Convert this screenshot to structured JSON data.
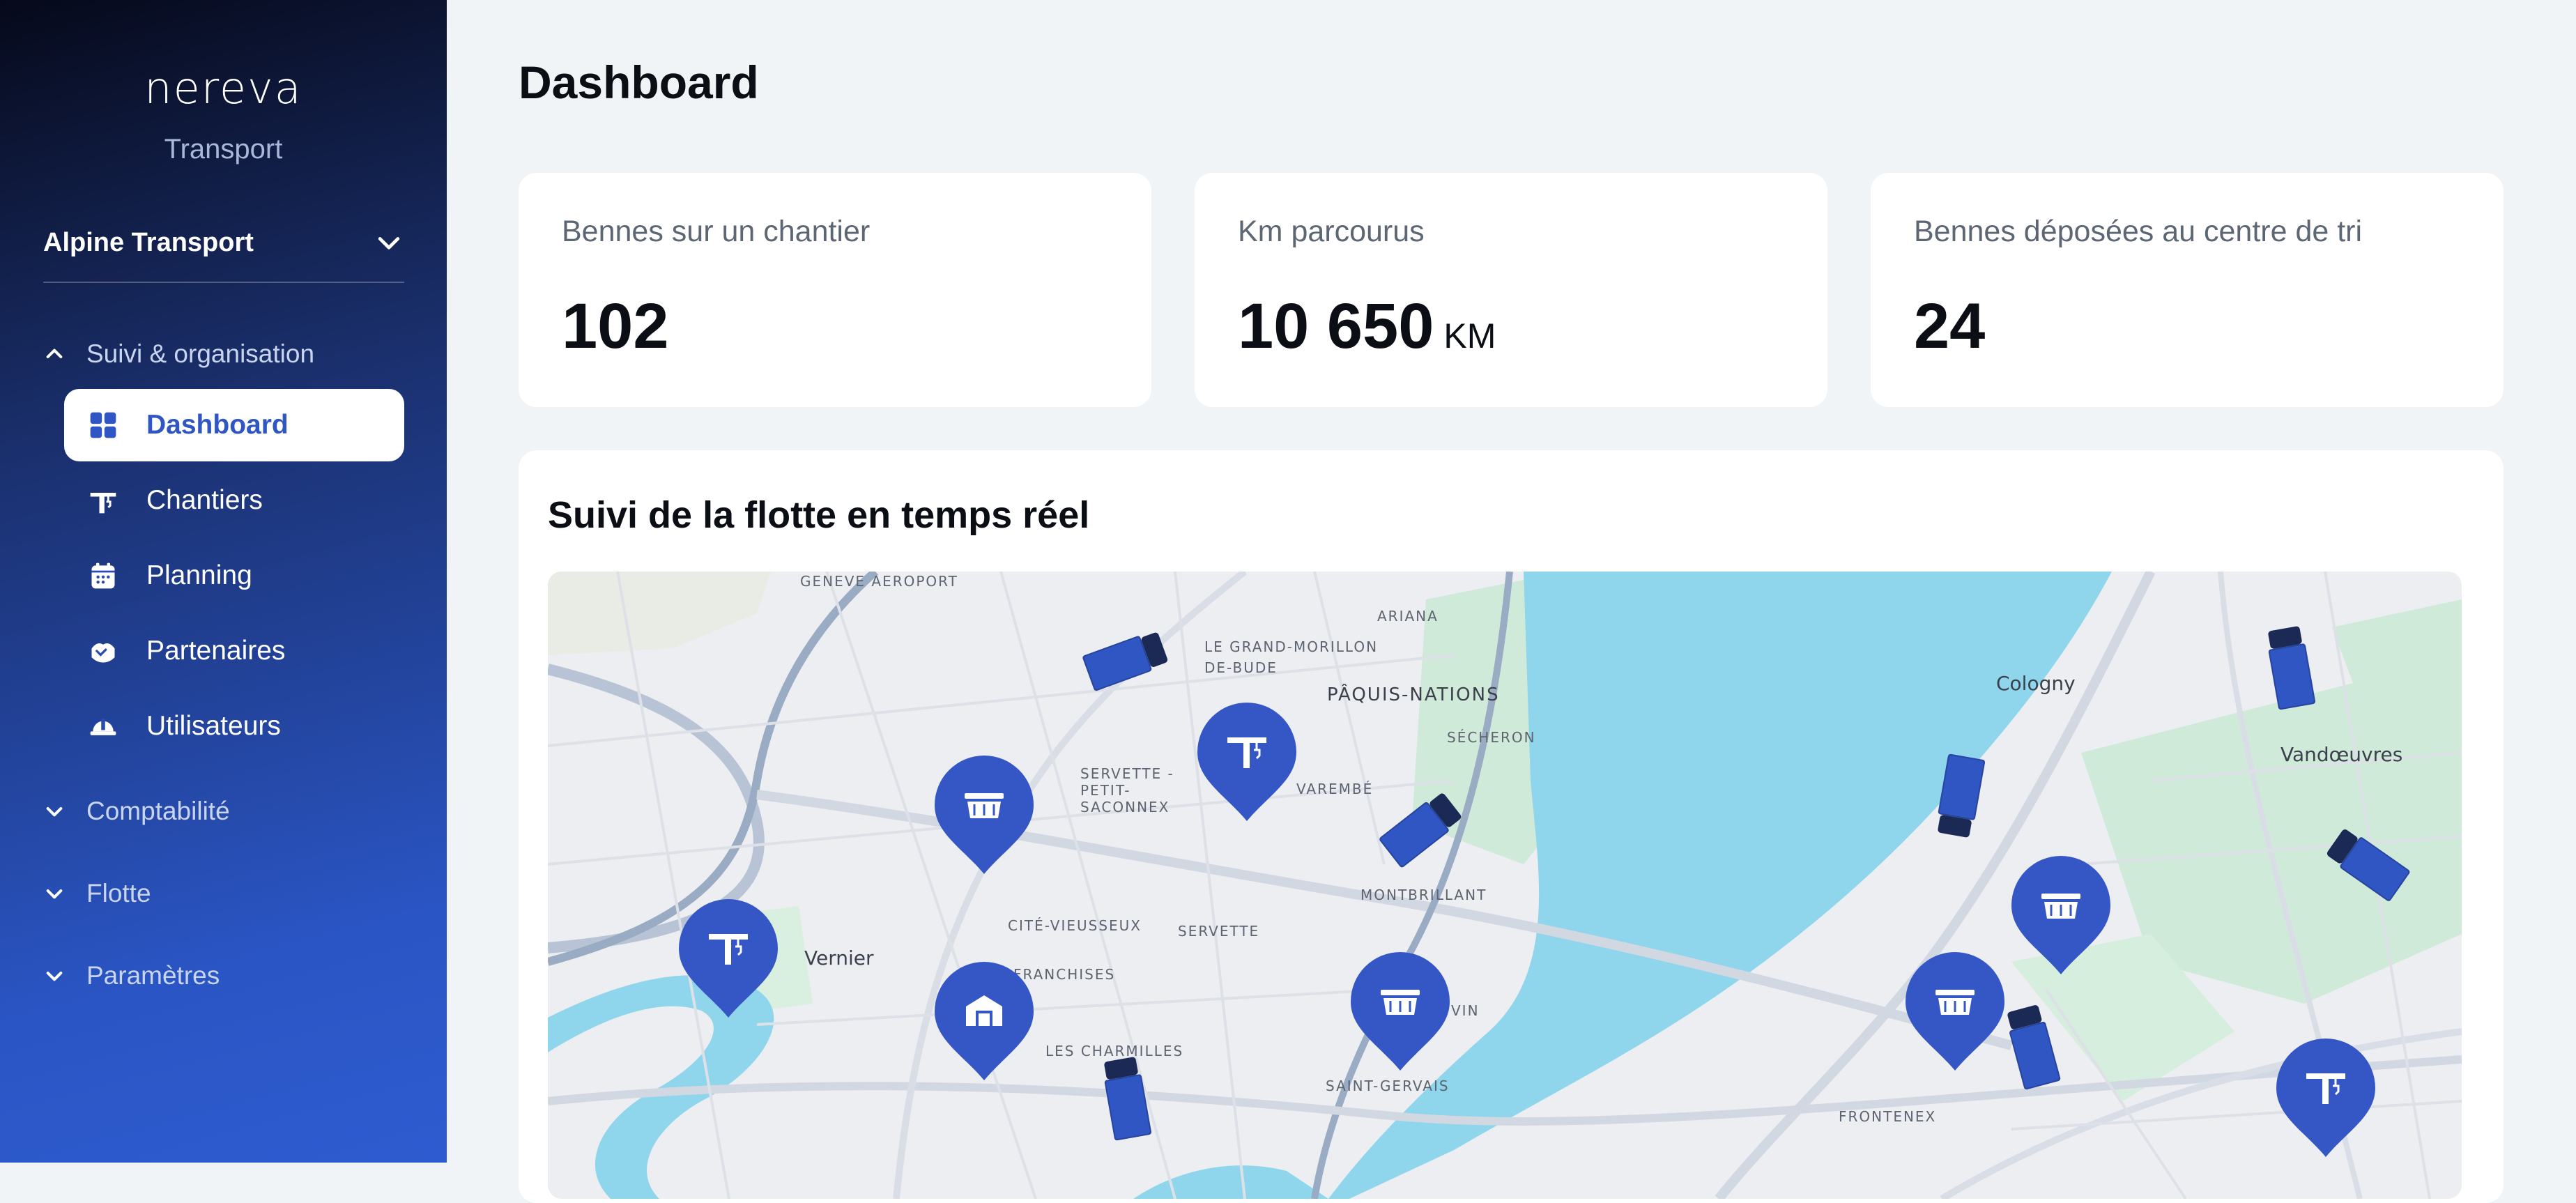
{
  "sidebar": {
    "logo": "nereva",
    "subtitle": "Transport",
    "organization": "Alpine Transport",
    "sections": [
      {
        "label": "Suivi & organisation",
        "expanded": true
      },
      {
        "label": "Comptabilité",
        "expanded": false
      },
      {
        "label": "Flotte",
        "expanded": false
      },
      {
        "label": "Paramètres",
        "expanded": false
      }
    ],
    "items": [
      {
        "label": "Dashboard",
        "icon": "grid-icon",
        "active": true
      },
      {
        "label": "Chantiers",
        "icon": "crane-icon"
      },
      {
        "label": "Planning",
        "icon": "calendar-icon"
      },
      {
        "label": "Partenaires",
        "icon": "handshake-icon"
      },
      {
        "label": "Utilisateurs",
        "icon": "hardhat-icon"
      }
    ]
  },
  "main": {
    "title": "Dashboard",
    "stats": [
      {
        "label": "Bennes sur un chantier",
        "value": "102",
        "unit": ""
      },
      {
        "label": "Km parcourus",
        "value": "10 650",
        "unit": "KM"
      },
      {
        "label": "Bennes déposées au centre de tri",
        "value": "24",
        "unit": ""
      }
    ],
    "map": {
      "title": "Suivi de la flotte en temps réel",
      "labels": [
        "GENEVE AEROPORT",
        "LE GRAND-MORILLON",
        "DE-BUDE",
        "ARIANA",
        "PÂQUIS-NATIONS",
        "SÉCHERON",
        "SERVETTE - PETIT-SACONNEX",
        "VAREMBÉ",
        "MONTBRILLANT",
        "CITÉ-VIEUSSEUX",
        "SERVETTE",
        "FRANCHISES",
        "LES CHARMILLES",
        "SAINT-GERVAIS",
        "VIN",
        "Vernier",
        "Cologny",
        "Vandœuvres",
        "FRONTENEX"
      ],
      "markers": [
        "crane-icon",
        "dumpster-icon",
        "crane-icon",
        "warehouse-icon",
        "dumpster-icon",
        "dumpster-icon",
        "dumpster-icon",
        "crane-icon"
      ],
      "vehicles": 7
    }
  },
  "colors": {
    "accent": "#2f56c3",
    "marker": "#3557c6",
    "water": "#8fd6ec",
    "park": "#c9ead3"
  }
}
